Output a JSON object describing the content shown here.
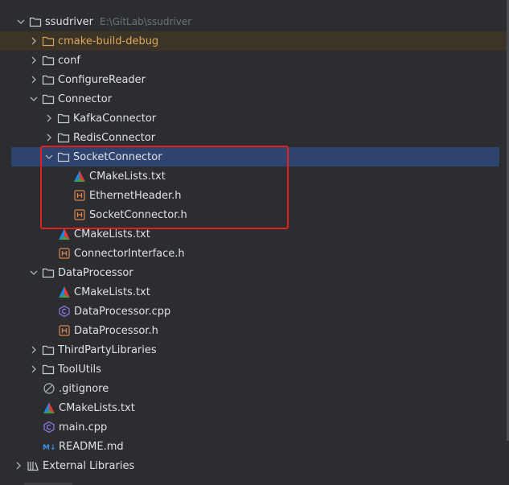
{
  "tree": {
    "root": {
      "label": "ssudriver",
      "path": "E:\\GitLab\\ssudriver"
    },
    "cmake_build_debug": "cmake-build-debug",
    "conf": "conf",
    "configure_reader": "ConfigureReader",
    "connector": "Connector",
    "kafka_connector": "KafkaConnector",
    "redis_connector": "RedisConnector",
    "socket_connector": "SocketConnector",
    "socket_cmakelists": "CMakeLists.txt",
    "ethernet_header": "EthernetHeader.h",
    "socket_connector_h": "SocketConnector.h",
    "connector_cmakelists": "CMakeLists.txt",
    "connector_interface": "ConnectorInterface.h",
    "data_processor": "DataProcessor",
    "dp_cmakelists": "CMakeLists.txt",
    "dp_cpp": "DataProcessor.cpp",
    "dp_h": "DataProcessor.h",
    "third_party": "ThirdPartyLibraries",
    "tool_utils": "ToolUtils",
    "gitignore": ".gitignore",
    "root_cmakelists": "CMakeLists.txt",
    "main_cpp": "main.cpp",
    "readme": "README.md",
    "external_libraries": "External Libraries"
  },
  "colors": {
    "background": "#2b2d30",
    "selected": "#2e436e",
    "excluded_bg": "#3b3427",
    "excluded_text": "#e0a85a",
    "highlight_border": "#e0201e"
  },
  "icons": {
    "folder": "folder-icon",
    "cmake": "cmake-icon",
    "header": "header-file-icon",
    "cpp": "cpp-file-icon",
    "gitignore": "ignore-file-icon",
    "markdown": "markdown-icon",
    "library": "library-icon"
  }
}
